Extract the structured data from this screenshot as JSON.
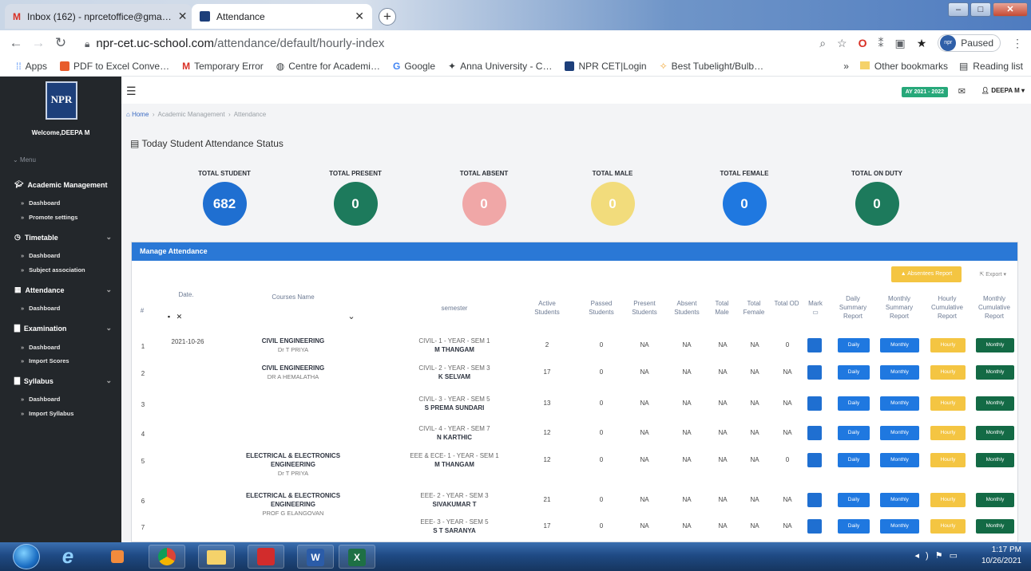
{
  "browser": {
    "tabs": [
      {
        "label": "Inbox (162) - nprcetoffice@gma…",
        "icon": "gmail-icon"
      },
      {
        "label": "Attendance",
        "icon": "site-icon"
      }
    ],
    "new_tab": "+",
    "url_host": "npr-cet.uc-school.com",
    "url_path": "/attendance/default/hourly-index",
    "profile_status": "Paused",
    "profile_initials": "npr",
    "bookmarks": [
      {
        "label": "Apps",
        "color": "#5f6368"
      },
      {
        "label": "PDF to Excel Conve…",
        "color": "#e85c2c"
      },
      {
        "label": "Temporary Error",
        "color": "#d93025"
      },
      {
        "label": "Centre for Academi…",
        "color": "#444444"
      },
      {
        "label": "Google",
        "color": "#4285f4"
      },
      {
        "label": "Anna University - C…",
        "color": "#555555"
      },
      {
        "label": "NPR CET|Login",
        "color": "#1d3f7a"
      },
      {
        "label": "Best Tubelight/Bulb…",
        "color": "#f2a93b"
      }
    ],
    "bm_more": "»",
    "other_bookmarks": "Other bookmarks",
    "reading_list": "Reading list"
  },
  "sidebar": {
    "logo": "NPR",
    "welcome": "Welcome,DEEPA M",
    "menu_label": "Menu",
    "sections": [
      {
        "label": "Academic Management",
        "subs": [
          "Dashboard",
          "Promote settings"
        ]
      },
      {
        "label": "Timetable",
        "subs": [
          "Dashboard",
          "Subject association"
        ]
      },
      {
        "label": "Attendance",
        "subs": [
          "Dashboard"
        ]
      },
      {
        "label": "Examination",
        "subs": [
          "Dashboard",
          "Import Scores"
        ]
      },
      {
        "label": "Syllabus",
        "subs": [
          "Dashboard",
          "Import Syllabus"
        ]
      }
    ]
  },
  "header": {
    "academic_year": "AY 2021 - 2022",
    "user": "DEEPA M"
  },
  "breadcrumb": {
    "home": "Home",
    "items": [
      "Academic Management",
      "Attendance"
    ]
  },
  "page_title": "Today Student Attendance Status",
  "stats": [
    {
      "label": "TOTAL STUDENT",
      "value": "682",
      "color": "#1f6fd1"
    },
    {
      "label": "TOTAL PRESENT",
      "value": "0",
      "color": "#1d7a5c"
    },
    {
      "label": "TOTAL ABSENT",
      "value": "0",
      "color": "#f0a7a7"
    },
    {
      "label": "TOTAL MALE",
      "value": "0",
      "color": "#f2dc7c"
    },
    {
      "label": "TOTAL FEMALE",
      "value": "0",
      "color": "#1f78e0"
    },
    {
      "label": "TOTAL ON DUTY",
      "value": "0",
      "color": "#1d7a5c"
    }
  ],
  "card": {
    "title": "Manage Attendance",
    "absent_report": "Absentees Report",
    "export": "Export",
    "headers": {
      "num": "#",
      "date": "Date.",
      "course": "Courses Name",
      "semester": "semester",
      "active": "Active Students",
      "passed": "Passed Students",
      "present": "Present Students",
      "absent": "Absent Students",
      "male": "Total Male",
      "female": "Total Female",
      "od": "Total OD",
      "mark": "Mark",
      "daily": "Daily Summary Report",
      "monthly": "Monthly Summary Report",
      "hourly": "Hourly Cumulative Report",
      "monthly_cum": "Monthly Cumulative Report"
    },
    "btn_daily": "Daily",
    "btn_monthly": "Monthly",
    "btn_hourly": "Hourly",
    "rows": [
      {
        "num": "1",
        "date": "2021-10-26",
        "course": "CIVIL ENGINEERING",
        "faculty": "Dr T PRIYA",
        "sem": "CIVIL- 1 - YEAR - SEM 1",
        "staff": "M THANGAM",
        "active": "2",
        "passed": "0",
        "present": "NA",
        "absent": "NA",
        "male": "NA",
        "female": "NA",
        "od": "0"
      },
      {
        "num": "2",
        "date": "",
        "course": "CIVIL ENGINEERING",
        "faculty": "DR A HEMALATHA",
        "sem": "CIVIL- 2 - YEAR - SEM 3",
        "staff": "K SELVAM",
        "active": "17",
        "passed": "0",
        "present": "NA",
        "absent": "NA",
        "male": "NA",
        "female": "NA",
        "od": "NA"
      },
      {
        "num": "3",
        "date": "",
        "course": "",
        "faculty": "",
        "sem": "CIVIL- 3 - YEAR - SEM 5",
        "staff": "S PREMA SUNDARI",
        "active": "13",
        "passed": "0",
        "present": "NA",
        "absent": "NA",
        "male": "NA",
        "female": "NA",
        "od": "NA"
      },
      {
        "num": "4",
        "date": "",
        "course": "",
        "faculty": "",
        "sem": "CIVIL- 4 - YEAR - SEM 7",
        "staff": "N KARTHIC",
        "active": "12",
        "passed": "0",
        "present": "NA",
        "absent": "NA",
        "male": "NA",
        "female": "NA",
        "od": "NA"
      },
      {
        "num": "5",
        "date": "",
        "course": "ELECTRICAL & ELECTRONICS ENGINEERING",
        "faculty": "Dr T PRIYA",
        "sem": "EEE & ECE- 1 - YEAR - SEM 1",
        "staff": "M THANGAM",
        "active": "12",
        "passed": "0",
        "present": "NA",
        "absent": "NA",
        "male": "NA",
        "female": "NA",
        "od": "0"
      },
      {
        "num": "6",
        "date": "",
        "course": "ELECTRICAL & ELECTRONICS ENGINEERING",
        "faculty": "PROF G ELANGOVAN",
        "sem": "EEE- 2 - YEAR - SEM 3",
        "staff": "SIVAKUMAR T",
        "active": "21",
        "passed": "0",
        "present": "NA",
        "absent": "NA",
        "male": "NA",
        "female": "NA",
        "od": "NA"
      },
      {
        "num": "7",
        "date": "",
        "course": "",
        "faculty": "",
        "sem": "EEE- 3 - YEAR - SEM 5",
        "staff": "S T SARANYA",
        "active": "17",
        "passed": "0",
        "present": "NA",
        "absent": "NA",
        "male": "NA",
        "female": "NA",
        "od": "NA"
      }
    ]
  },
  "taskbar": {
    "time": "1:17 PM",
    "date": "10/26/2021",
    "apps": [
      "ie-icon",
      "media-player-icon",
      "chrome-icon",
      "folder-icon",
      "acrobat-icon",
      "word-icon",
      "excel-icon"
    ]
  }
}
